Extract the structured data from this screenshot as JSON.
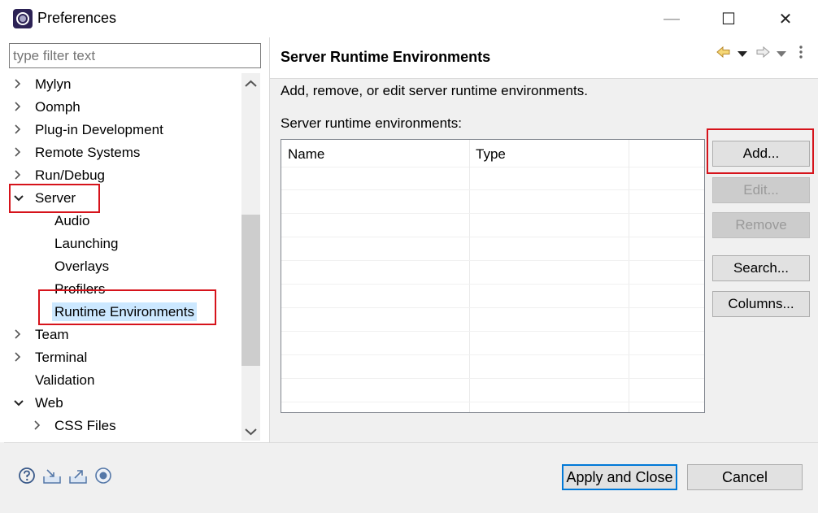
{
  "window": {
    "title": "Preferences",
    "minimize_glyph": "—",
    "maximize_glyph": "☐",
    "close_glyph": "✕"
  },
  "filter": {
    "placeholder": "type filter text"
  },
  "tree": {
    "items": [
      {
        "label": "Mylyn",
        "level": 0,
        "state": "collapsed"
      },
      {
        "label": "Oomph",
        "level": 0,
        "state": "collapsed"
      },
      {
        "label": "Plug-in Development",
        "level": 0,
        "state": "collapsed"
      },
      {
        "label": "Remote Systems",
        "level": 0,
        "state": "collapsed"
      },
      {
        "label": "Run/Debug",
        "level": 0,
        "state": "collapsed"
      },
      {
        "label": "Server",
        "level": 0,
        "state": "expanded"
      },
      {
        "label": "Audio",
        "level": 1,
        "state": "leaf"
      },
      {
        "label": "Launching",
        "level": 1,
        "state": "leaf"
      },
      {
        "label": "Overlays",
        "level": 1,
        "state": "leaf"
      },
      {
        "label": "Profilers",
        "level": 1,
        "state": "leaf"
      },
      {
        "label": "Runtime Environments",
        "level": 1,
        "state": "leaf",
        "selected": true
      },
      {
        "label": "Team",
        "level": 0,
        "state": "collapsed"
      },
      {
        "label": "Terminal",
        "level": 0,
        "state": "collapsed"
      },
      {
        "label": "Validation",
        "level": 0,
        "state": "leaf"
      },
      {
        "label": "Web",
        "level": 0,
        "state": "expanded"
      },
      {
        "label": "CSS Files",
        "level": 1,
        "state": "collapsed"
      }
    ]
  },
  "page": {
    "title": "Server Runtime Environments",
    "description": "Add, remove, or edit server runtime environments.",
    "list_label": "Server runtime environments:",
    "columns": [
      "Name",
      "Type"
    ],
    "buttons": {
      "add": "Add...",
      "edit": "Edit...",
      "remove": "Remove",
      "search": "Search...",
      "columns": "Columns..."
    }
  },
  "footer": {
    "apply_close": "Apply and Close",
    "cancel": "Cancel"
  },
  "colors": {
    "highlight": "#d6131b",
    "selection": "#cce8ff"
  }
}
